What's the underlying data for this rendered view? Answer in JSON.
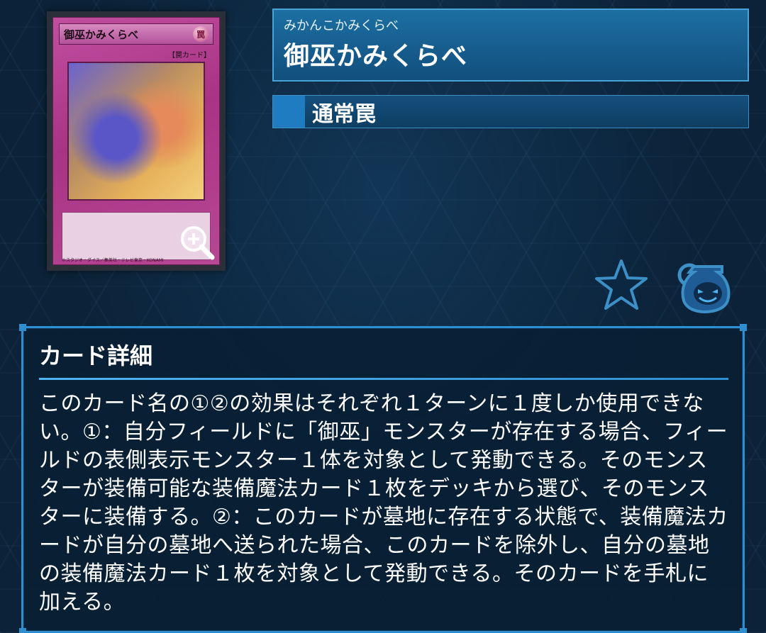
{
  "card": {
    "name_on_card": "御巫かみくらべ",
    "attribute_glyph": "罠",
    "type_line": "【罠カード】",
    "copyright": "©スタジオ・ダイス／集英社・テレビ東京・KONAMI",
    "zoom_icon": "magnify-plus-icon"
  },
  "header": {
    "ruby": "みかんこかみくらべ",
    "name": "御巫かみくらべ",
    "type": "通常罠"
  },
  "actions": {
    "favorite_icon": "star-icon",
    "deck_icon": "pot-icon"
  },
  "details": {
    "heading": "カード詳細",
    "text": "このカード名の①②の効果はそれぞれ１ターンに１度しか使用できない。①：自分フィールドに「御巫」モンスターが存在する場合、フィールドの表側表示モンスター１体を対象として発動できる。そのモンスターが装備可能な装備魔法カード１枚をデッキから選び、そのモンスターに装備する。②：このカードが墓地に存在する状態で、装備魔法カードが自分の墓地へ送られた場合、このカードを除外し、自分の墓地の装備魔法カード１枚を対象として発動できる。そのカードを手札に加える。"
  },
  "colors": {
    "accent": "#2f8ed0",
    "header_bg": "#1d6fa3",
    "trap_card": "#b64894"
  }
}
